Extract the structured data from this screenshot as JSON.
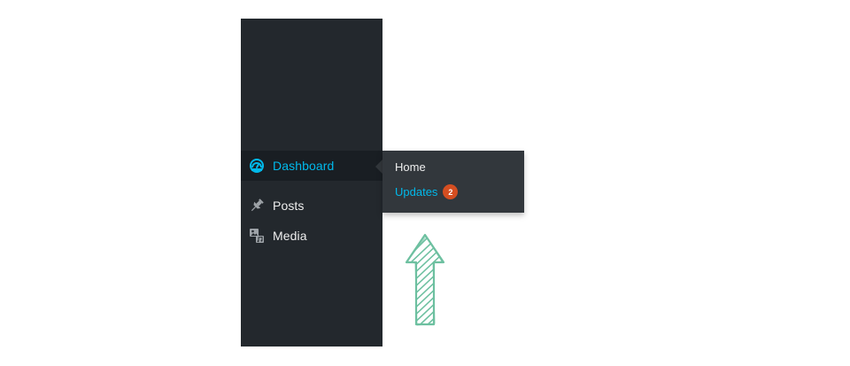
{
  "menu": {
    "items": [
      {
        "label": "Dashboard",
        "icon": "dashboard-icon",
        "current": true
      },
      {
        "label": "Posts",
        "icon": "pushpin-icon",
        "current": false
      },
      {
        "label": "Media",
        "icon": "media-icon",
        "current": false
      }
    ]
  },
  "flyout": {
    "items": [
      {
        "label": "Home"
      },
      {
        "label": "Updates",
        "badge": "2"
      }
    ]
  },
  "annotation": {
    "icon": "hand-drawn-arrow-up-icon",
    "color": "#6dc0a0"
  },
  "colors": {
    "menu_bg": "#23282d",
    "current_bg": "#191e23",
    "flyout_bg": "#32373c",
    "accent": "#00b9eb",
    "badge": "#d54e21",
    "text": "#eeeeee"
  }
}
